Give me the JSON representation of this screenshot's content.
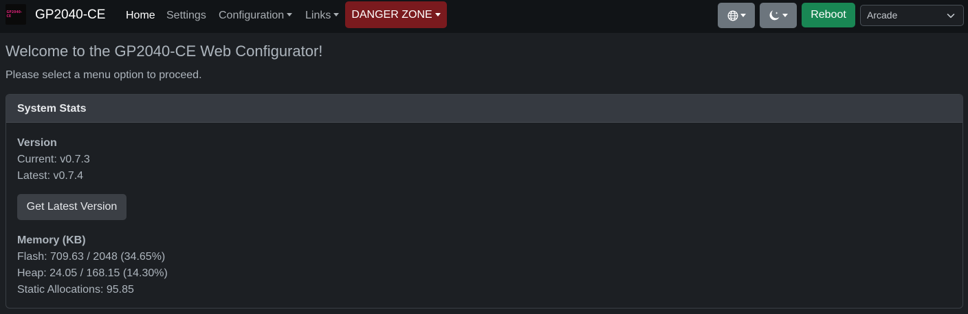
{
  "navbar": {
    "logo_text": "GP2040-CE",
    "brand": "GP2040-CE",
    "links": [
      {
        "label": "Home"
      },
      {
        "label": "Settings"
      },
      {
        "label": "Configuration"
      },
      {
        "label": "Links"
      }
    ],
    "danger_label": "DANGER ZONE",
    "reboot_label": "Reboot",
    "profile_select": "Arcade",
    "language_icon": "globe-icon",
    "theme_icon": "moon-stars-icon"
  },
  "main": {
    "title": "Welcome to the GP2040-CE Web Configurator!",
    "subtitle": "Please select a menu option to proceed."
  },
  "system_stats": {
    "header": "System Stats",
    "version_heading": "Version",
    "current": "Current: v0.7.3",
    "latest": "Latest: v0.7.4",
    "get_latest_label": "Get Latest Version",
    "memory_heading": "Memory (KB)",
    "flash": "Flash: 709.63 / 2048 (34.65%)",
    "heap": "Heap: 24.05 / 168.15 (14.30%)",
    "static_allocations": "Static Allocations: 95.85"
  },
  "colors": {
    "navbar_bg": "#111417",
    "danger": "#7a1a1e",
    "reboot": "#198754",
    "secondary": "#6c757d"
  }
}
